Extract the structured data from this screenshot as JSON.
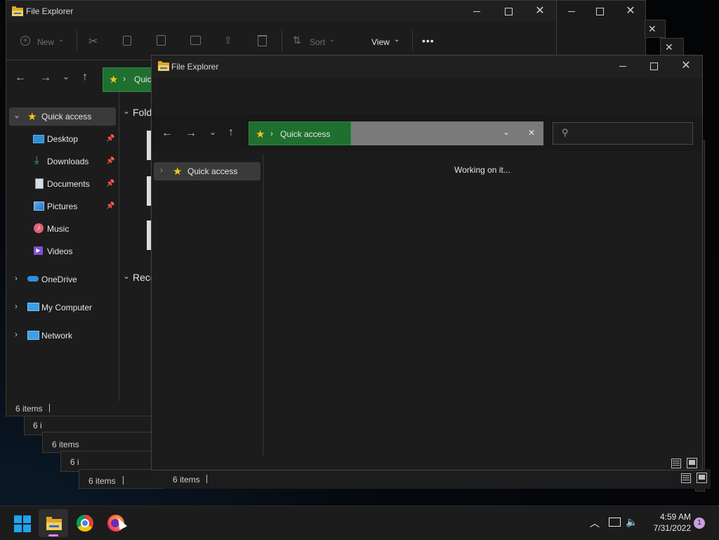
{
  "app_title": "File Explorer",
  "background_window": {
    "toolbar": {
      "new_label": "New",
      "sort_label": "Sort",
      "view_label": "View",
      "more_label": "•••"
    },
    "address_partial": "Quic",
    "sections": {
      "folders_partial": "Fold",
      "recent_partial": "Rece"
    },
    "sidebar": {
      "quick_access": "Quick access",
      "items": [
        {
          "label": "Desktop",
          "icon": "desktop-icon",
          "pinned": true
        },
        {
          "label": "Downloads",
          "icon": "download-icon",
          "pinned": true
        },
        {
          "label": "Documents",
          "icon": "document-icon",
          "pinned": true
        },
        {
          "label": "Pictures",
          "icon": "pictures-icon",
          "pinned": true
        },
        {
          "label": "Music",
          "icon": "music-icon",
          "pinned": false
        },
        {
          "label": "Videos",
          "icon": "videos-icon",
          "pinned": false
        }
      ],
      "onedrive": "OneDrive",
      "my_computer": "My Computer",
      "network": "Network"
    },
    "status": "6 items"
  },
  "stacked_status": [
    "6 i",
    "6 items",
    "6 i",
    "6 items",
    "6 items"
  ],
  "front_window": {
    "title": "File Explorer",
    "address_label": "Quick access",
    "sidebar_item": "Quick access",
    "loading_text": "Working on it..."
  },
  "taskbar": {
    "time": "4:59 AM",
    "date": "7/31/2022",
    "notification_count": "1"
  },
  "colors": {
    "accent_green": "#1f6f2f",
    "star": "#f5c518",
    "windows_blue": "#1fa3f2"
  }
}
